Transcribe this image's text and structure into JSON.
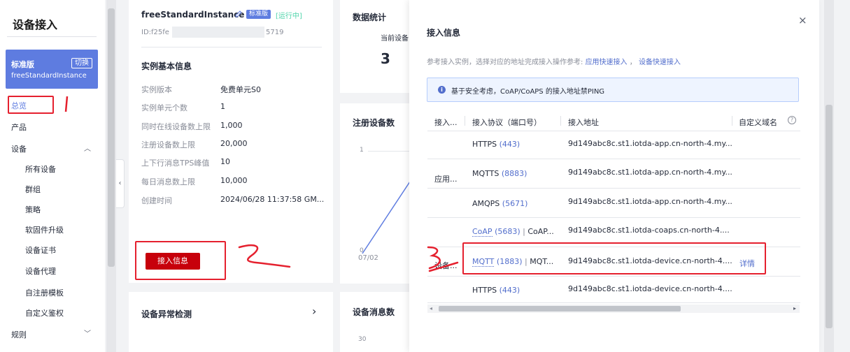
{
  "sidebar": {
    "title": "设备接入",
    "edition": "标准版",
    "switch": "切换",
    "instance": "freeStandardInstance",
    "items": [
      {
        "label": "总览"
      },
      {
        "label": "产品"
      },
      {
        "label": "设备"
      },
      {
        "label": "所有设备"
      },
      {
        "label": "群组"
      },
      {
        "label": "策略"
      },
      {
        "label": "软固件升级"
      },
      {
        "label": "设备证书"
      },
      {
        "label": "设备代理"
      },
      {
        "label": "自注册模板"
      },
      {
        "label": "自定义鉴权"
      },
      {
        "label": "规则"
      }
    ]
  },
  "instance": {
    "name": "freeStandardInstance",
    "badge_standard": "标准版",
    "badge_running": "[运行中]",
    "id_prefix": "ID:f25fe",
    "id_suffix": "5719",
    "section_title": "实例基本信息",
    "rows": [
      {
        "label": "实例版本",
        "value": "免费单元S0"
      },
      {
        "label": "实例单元个数",
        "value": "1"
      },
      {
        "label": "同时在线设备数上限",
        "value": "1,000"
      },
      {
        "label": "注册设备数上限",
        "value": "20,000"
      },
      {
        "label": "上下行消息TPS峰值",
        "value": "10"
      },
      {
        "label": "每日消息数上限",
        "value": "10,000"
      },
      {
        "label": "创建时间",
        "value": "2024/06/28 11:37:58 GM..."
      }
    ],
    "connect_button": "接入信息",
    "anomaly_title": "设备异常检测"
  },
  "stats": {
    "title": "数据统计",
    "current_label": "当前设备",
    "current_value": "3",
    "registered_title": "注册设备数",
    "y_tick": "1",
    "y_zero": "0",
    "x_tick": "07/02",
    "messages_title": "设备消息数",
    "messages_tick": "30"
  },
  "drawer": {
    "title": "接入信息",
    "hint_prefix": "参考接入实例，选择对应的地址完成接入操作参考:",
    "link_app": "应用快速接入",
    "separator": "，",
    "link_device": "设备快速接入",
    "notice": "基于安全考虑，CoAP/CoAPS 的接入地址禁PING",
    "columns": [
      "接入...",
      "接入协议（端口号）",
      "接入地址",
      "自定义域名"
    ],
    "group_app": "应用...",
    "group_device": "设备...",
    "rows": [
      {
        "protocol": "HTTPS",
        "port": "(443)",
        "extra": "",
        "address": "9d149abc8c.st1.iotda-app.cn-north-4.my...",
        "action": ""
      },
      {
        "protocol": "MQTTS",
        "port": "(8883)",
        "extra": "",
        "address": "9d149abc8c.st1.iotda-app.cn-north-4.my...",
        "action": ""
      },
      {
        "protocol": "AMQPS",
        "port": "(5671)",
        "extra": "",
        "address": "9d149abc8c.st1.iotda-app.cn-north-4.my...",
        "action": ""
      },
      {
        "protocol": "CoAP",
        "port": "(5683)",
        "extra": "CoAP...",
        "address": "9d149abc8c.st1.iotda-coaps.cn-north-4....",
        "action": ""
      },
      {
        "protocol": "MQTT",
        "port": "(1883)",
        "extra": "MQT...",
        "address": "9d149abc8c.st1.iotda-device.cn-north-4....",
        "action": "详情"
      },
      {
        "protocol": "HTTPS",
        "port": "(443)",
        "extra": "",
        "address": "9d149abc8c.st1.iotda-device.cn-north-4....",
        "action": ""
      }
    ]
  },
  "colors": {
    "accent": "#5e7ce0",
    "danger": "#c7000b",
    "annotation": "#e5202e"
  }
}
